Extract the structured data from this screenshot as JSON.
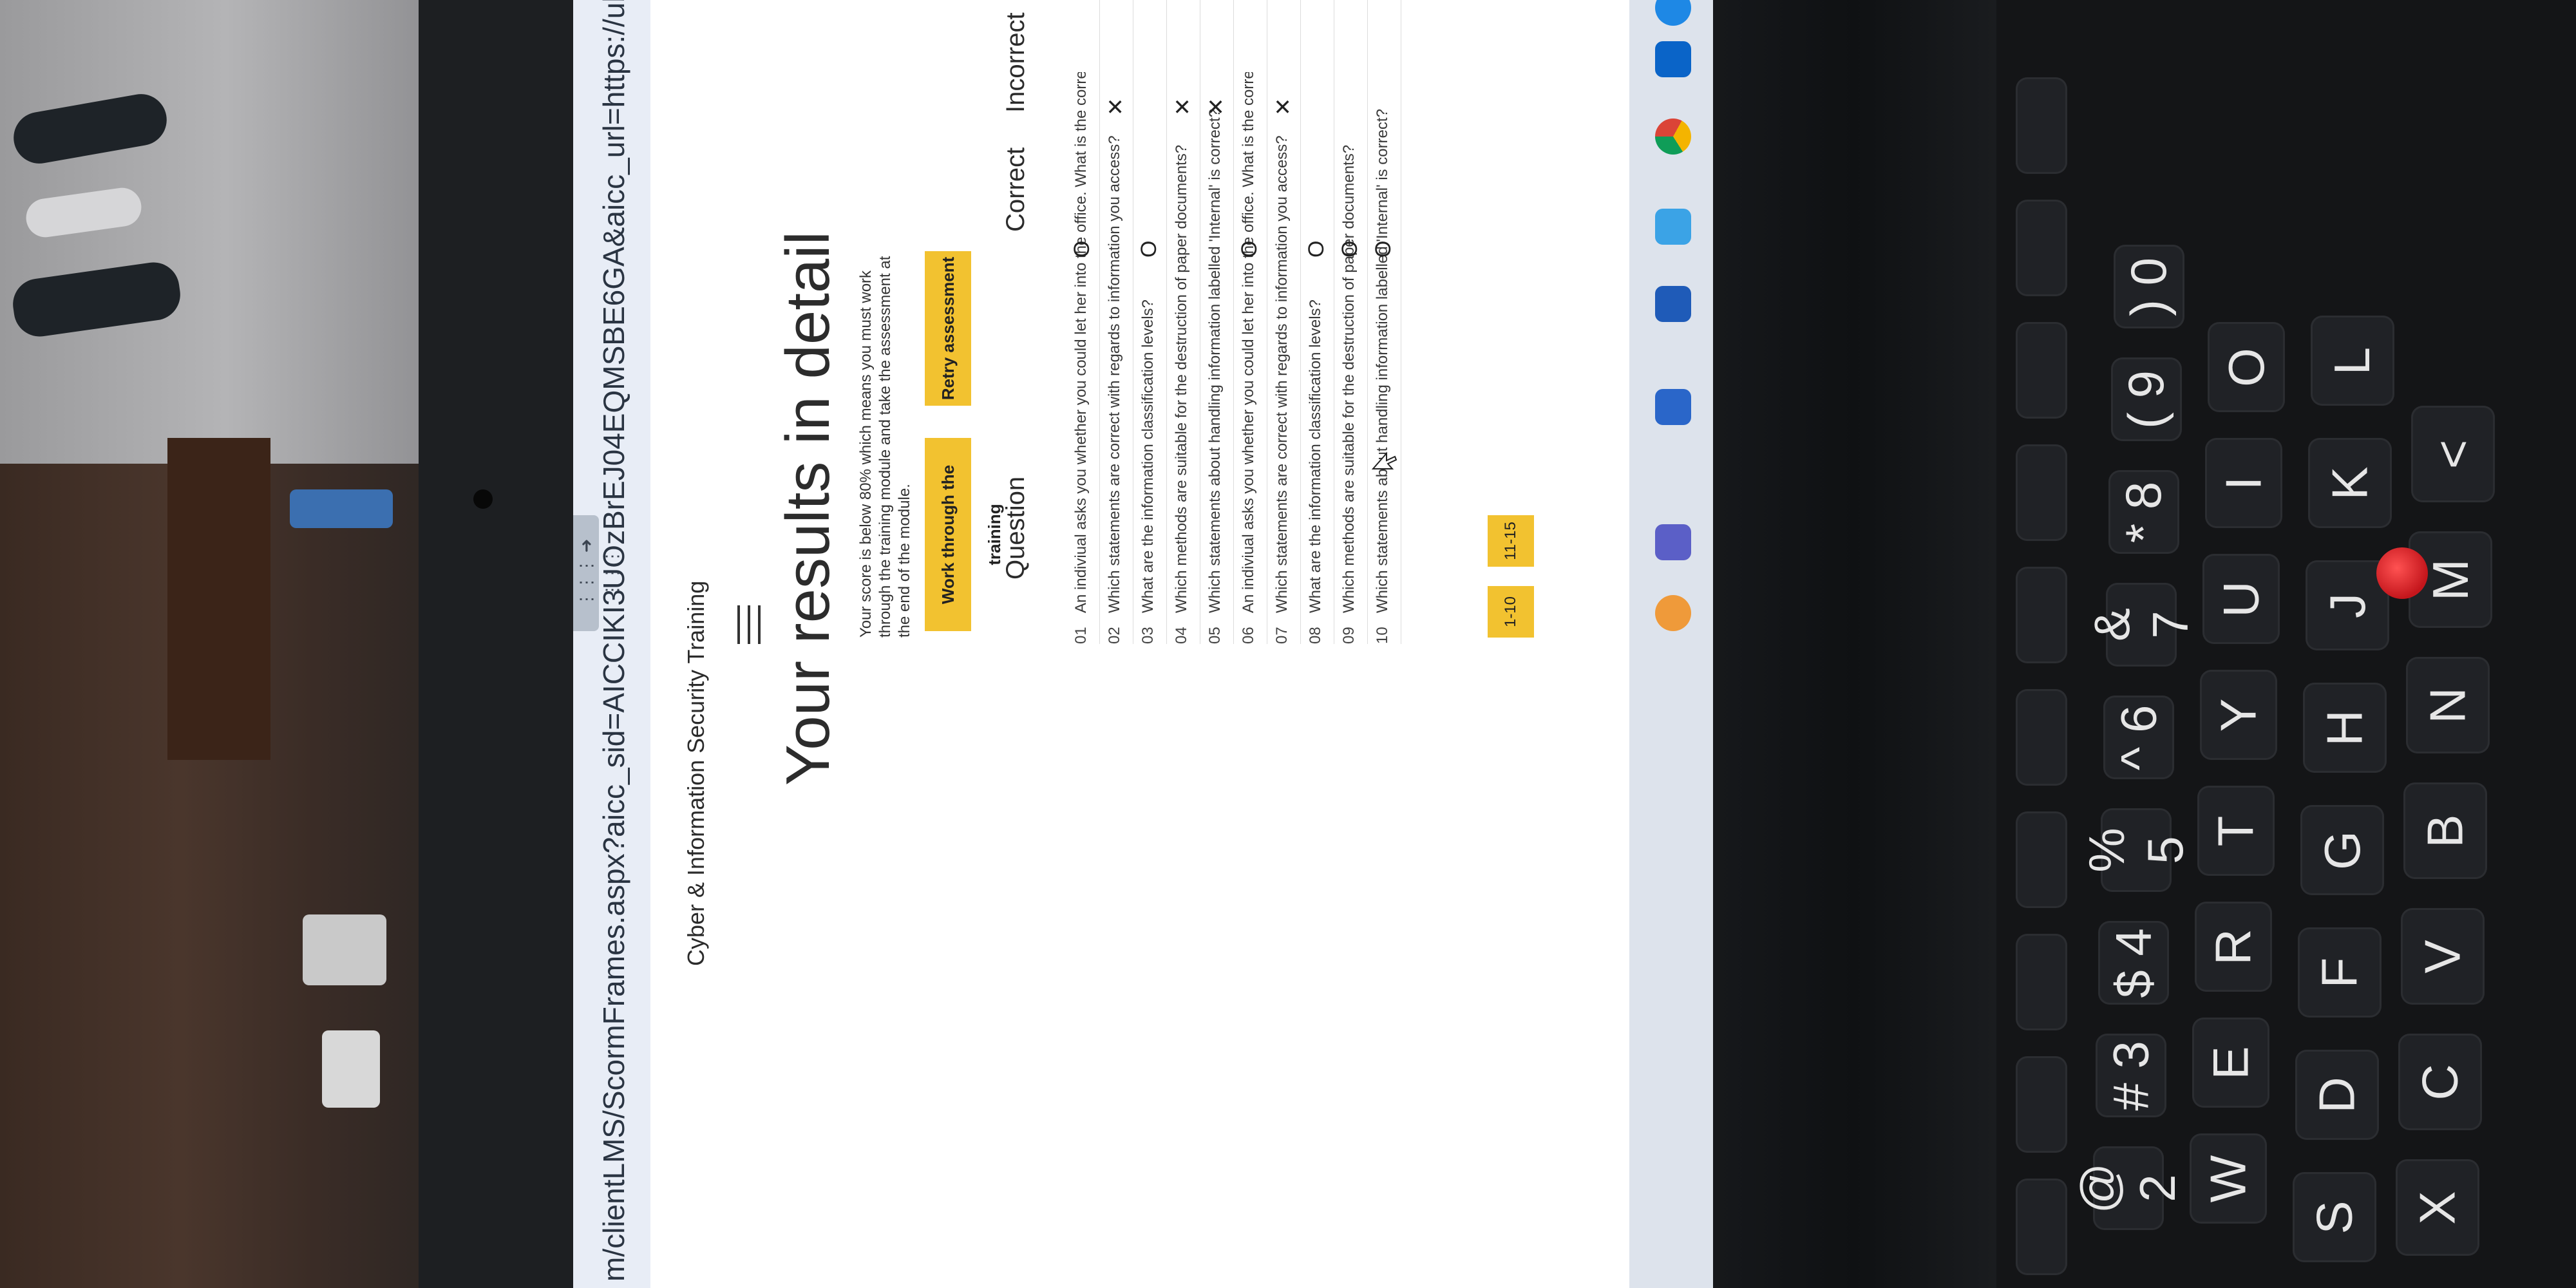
{
  "browser": {
    "url": "m/clientLMS/ScormFrames.aspx?aicc_sid=AICCIKI3UOzBrEJ04EQMSBE6GA&aicc_url=https://ubs.csod.com/LMS/scorm/aicc"
  },
  "course": {
    "title": "Cyber & Information Security Training"
  },
  "results": {
    "heading": "Your results in detail",
    "score_message": "Your score is below 80% which means you must work through the training module and take the assessment at the end of the module.",
    "work_button": "Work through the training",
    "retry_button": "Retry assessment",
    "columns": {
      "question": "Question",
      "correct": "Correct",
      "incorrect": "Incorrect"
    },
    "correct_symbol": "O",
    "incorrect_symbol": "✕",
    "rows": [
      {
        "num": "01",
        "question": "An indiviual asks you whether you could let her into the office. What is the correct course of action?",
        "result": "correct"
      },
      {
        "num": "02",
        "question": "Which statements are correct with  regards to information you access?",
        "result": "incorrect"
      },
      {
        "num": "03",
        "question": "What are the information classification levels?",
        "result": "correct"
      },
      {
        "num": "04",
        "question": "Which methods are suitable for the destruction of paper documents?",
        "result": "incorrect"
      },
      {
        "num": "05",
        "question": "Which statements about handling information labelled 'Internal' is correct?",
        "result": "incorrect"
      },
      {
        "num": "06",
        "question": "An indiviual asks you whether you could let her into the office. What is the correct course of action?",
        "result": "correct"
      },
      {
        "num": "07",
        "question": "Which statements are correct with  regards to information you access?",
        "result": "incorrect"
      },
      {
        "num": "08",
        "question": "What are the information classification levels?",
        "result": "correct"
      },
      {
        "num": "09",
        "question": "Which methods are suitable for the destruction of paper documents?",
        "result": "correct"
      },
      {
        "num": "10",
        "question": "Which statements about handling information labelled 'Internal' is correct?",
        "result": "correct"
      }
    ],
    "pages": [
      "1-10",
      "11-15"
    ]
  },
  "taskbar": {
    "icons": [
      "skype-icon",
      "outlook-icon",
      "chrome-icon",
      "edge-icon",
      "word-icon",
      "app-icon",
      "teams-icon",
      "feedback-icon"
    ]
  },
  "keyboard": {
    "number_row": [
      "@ 2",
      "# 3",
      "$ 4",
      "% 5",
      "^ 6",
      "& 7",
      "* 8",
      "( 9",
      ") 0"
    ],
    "top_row": [
      "W",
      "E",
      "R",
      "T",
      "Y",
      "U",
      "I",
      "O"
    ],
    "home_row": [
      "S",
      "D",
      "F",
      "G",
      "H",
      "J",
      "K",
      "L"
    ],
    "bottom_row": [
      "X",
      "C",
      "V",
      "B",
      "N",
      "M",
      "<"
    ]
  },
  "colors": {
    "button_yellow": "#f2c230",
    "text_dark": "#2b2b2b",
    "trackpoint_red": "#d0181f"
  }
}
